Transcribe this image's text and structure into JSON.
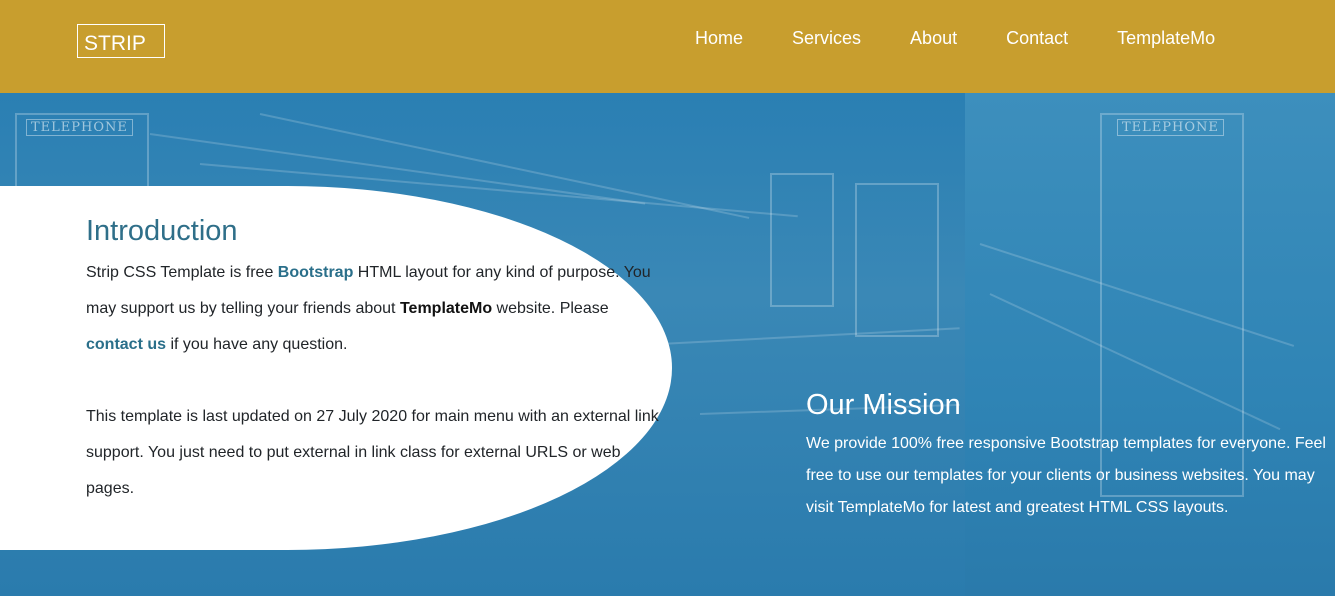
{
  "header": {
    "logo": "STRIP",
    "nav": [
      {
        "label": "Home"
      },
      {
        "label": "Services"
      },
      {
        "label": "About"
      },
      {
        "label": "Contact"
      },
      {
        "label": "TemplateMo"
      }
    ]
  },
  "intro": {
    "title": "Introduction",
    "p1_a": "Strip CSS Template is free ",
    "p1_link": "Bootstrap",
    "p1_b": " HTML layout for any kind of purpose. You may support us by telling your friends about ",
    "p1_strong": "TemplateMo",
    "p1_c": " website. Please ",
    "p1_contact": "contact us",
    "p1_d": " if you have any question.",
    "p2": "This template is last updated on 27 July 2020 for main menu with an external link support. You just need to put external in link class for external URLS or web pages."
  },
  "mission": {
    "title": "Our Mission",
    "text": "We provide 100% free responsive Bootstrap templates for everyone. Feel free to use our templates for your clients or business websites. You may visit TemplateMo for latest and greatest HTML CSS layouts."
  },
  "background": {
    "sign_left": "TELEPHONE",
    "sign_right": "TELEPHONE"
  },
  "colors": {
    "header_bg": "#c89e2e",
    "hero_bg": "#2b7fb0",
    "accent_link": "#2a6f8a"
  }
}
